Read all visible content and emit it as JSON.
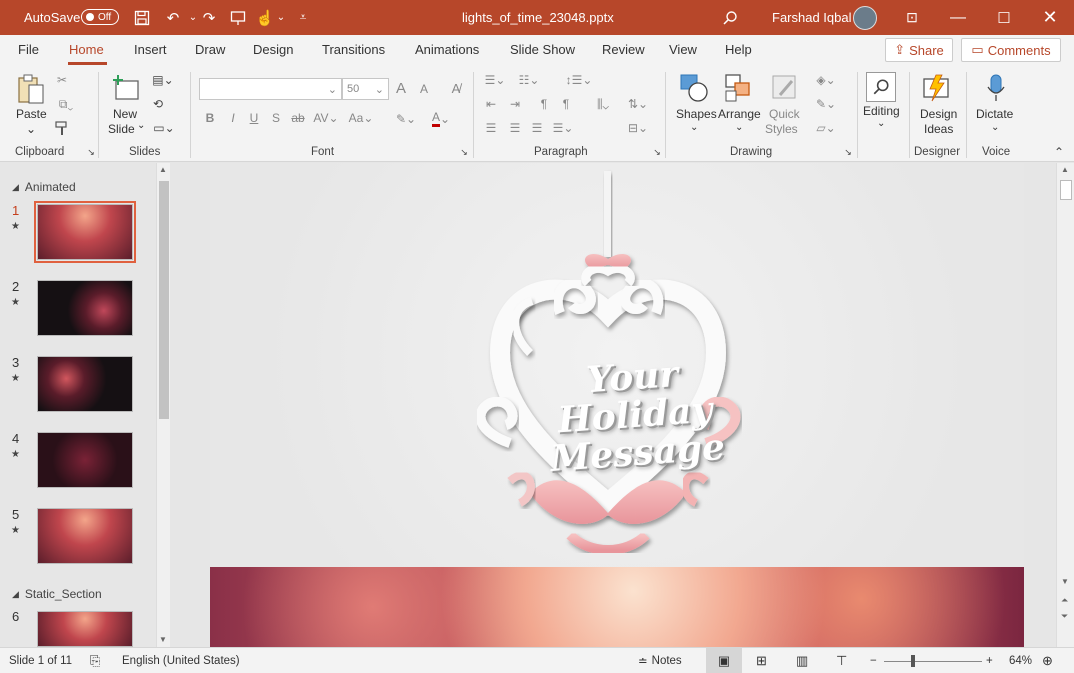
{
  "titlebar": {
    "autosave_label": "AutoSave",
    "autosave_state": "Off",
    "document_title": "lights_of_time_23048.pptx",
    "user_name": "Farshad Iqbal"
  },
  "tabs": [
    "File",
    "Home",
    "Insert",
    "Draw",
    "Design",
    "Transitions",
    "Animations",
    "Slide Show",
    "Review",
    "View",
    "Help"
  ],
  "active_tab": "Home",
  "share_label": "Share",
  "comments_label": "Comments",
  "ribbon": {
    "clipboard": {
      "paste": "Paste",
      "group": "Clipboard"
    },
    "slides": {
      "new_slide_1": "New",
      "new_slide_2": "Slide",
      "group": "Slides"
    },
    "font": {
      "font_name": "",
      "font_size": "50",
      "bold": "B",
      "italic": "I",
      "underline": "U",
      "strike": "ab",
      "spacing": "AV",
      "case": "Aa",
      "grow": "A",
      "shrink": "A",
      "group": "Font"
    },
    "paragraph": {
      "group": "Paragraph"
    },
    "drawing": {
      "shapes": "Shapes",
      "arrange": "Arrange",
      "quick_styles_1": "Quick",
      "quick_styles_2": "Styles",
      "group": "Drawing"
    },
    "editing": {
      "label": "Editing"
    },
    "designer": {
      "design_ideas_1": "Design",
      "design_ideas_2": "Ideas",
      "group": "Designer"
    },
    "voice": {
      "dictate": "Dictate",
      "group": "Voice"
    }
  },
  "slide_panel": {
    "sections": [
      {
        "name": "Animated"
      },
      {
        "name": "Static_Section"
      }
    ],
    "slides": [
      {
        "number": "1",
        "animated": true
      },
      {
        "number": "2",
        "animated": true
      },
      {
        "number": "3",
        "animated": true
      },
      {
        "number": "4",
        "animated": true
      },
      {
        "number": "5",
        "animated": true
      },
      {
        "number": "6",
        "animated": false
      }
    ]
  },
  "slide_content": {
    "line1": "Your",
    "line2": "Holiday",
    "line3": "Message"
  },
  "statusbar": {
    "slide_info": "Slide 1 of 11",
    "language": "English (United States)",
    "notes": "Notes",
    "zoom": "64%"
  },
  "colors": {
    "accent": "#b7472a",
    "active_thumb_border": "#e0613f"
  }
}
